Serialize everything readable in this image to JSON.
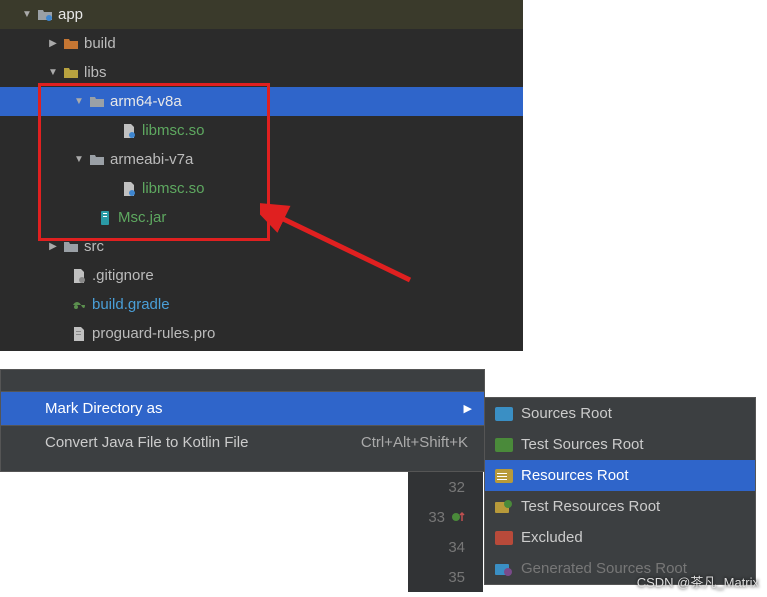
{
  "tree": {
    "app": "app",
    "build": "build",
    "libs": "libs",
    "arm64": "arm64-v8a",
    "libmsc1": "libmsc.so",
    "armeabi": "armeabi-v7a",
    "libmsc2": "libmsc.so",
    "mscjar": "Msc.jar",
    "src": "src",
    "gitignore": ".gitignore",
    "buildgradle": "build.gradle",
    "proguard": "proguard-rules.pro"
  },
  "menu": {
    "mark_dir": "Mark Directory as",
    "convert": "Convert Java File to Kotlin File",
    "convert_kb": "Ctrl+Alt+Shift+K"
  },
  "gutter": {
    "l32": "32",
    "l33": "33",
    "l34": "34",
    "l35": "35"
  },
  "submenu": {
    "sources": "Sources Root",
    "test_sources": "Test Sources Root",
    "resources": "Resources Root",
    "test_resources": "Test Resources Root",
    "excluded": "Excluded",
    "generated": "Generated Sources Root"
  },
  "watermark": "CSDN @茶凡_Matrix"
}
